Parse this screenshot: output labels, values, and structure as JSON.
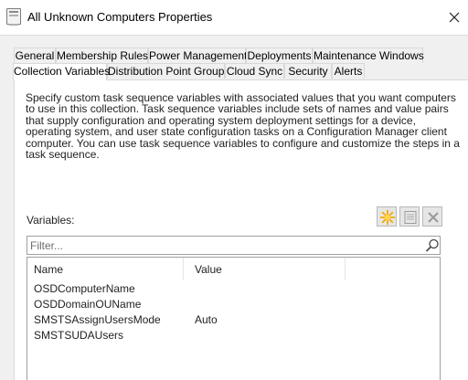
{
  "window": {
    "title": "All Unknown Computers Properties",
    "icon": "properties-window-icon",
    "close_icon": "close-icon"
  },
  "tabs_row_back": [
    {
      "label": "General"
    },
    {
      "label": "Membership Rules"
    },
    {
      "label": "Power Management"
    },
    {
      "label": "Deployments"
    },
    {
      "label": "Maintenance Windows"
    }
  ],
  "tabs_row_front": [
    {
      "label": "Collection Variables",
      "selected": true
    },
    {
      "label": "Distribution Point Groups"
    },
    {
      "label": "Cloud Sync"
    },
    {
      "label": "Security"
    },
    {
      "label": "Alerts"
    }
  ],
  "panel": {
    "description": "Specify custom task sequence variables with associated values that you want computers to use in this collection. Task sequence variables include sets of names and value pairs that supply configuration and operating system deployment settings for a device, operating system, and user state configuration tasks on a Configuration Manager client computer. You can use task sequence variables to configure and customize the steps in a task sequence.",
    "variables_label": "Variables:",
    "toolbar": {
      "new_icon": "new-star-icon",
      "properties_icon": "properties-icon",
      "delete_icon": "delete-x-icon"
    },
    "filter": {
      "placeholder": "Filter...",
      "value": "",
      "icon": "search-icon"
    },
    "list": {
      "columns": [
        "Name",
        "Value"
      ],
      "rows": [
        {
          "name": "OSDComputerName",
          "value": ""
        },
        {
          "name": "OSDDomainOUName",
          "value": ""
        },
        {
          "name": "SMSTSAssignUsersMode",
          "value": "Auto"
        },
        {
          "name": "SMSTSUDAUsers",
          "value": ""
        }
      ]
    }
  },
  "colors": {
    "dialog_bg": "#f0f0f0",
    "panel_bg": "#ffffff",
    "tab_border": "#d9d9d9",
    "star_accent": "#f5a800"
  }
}
